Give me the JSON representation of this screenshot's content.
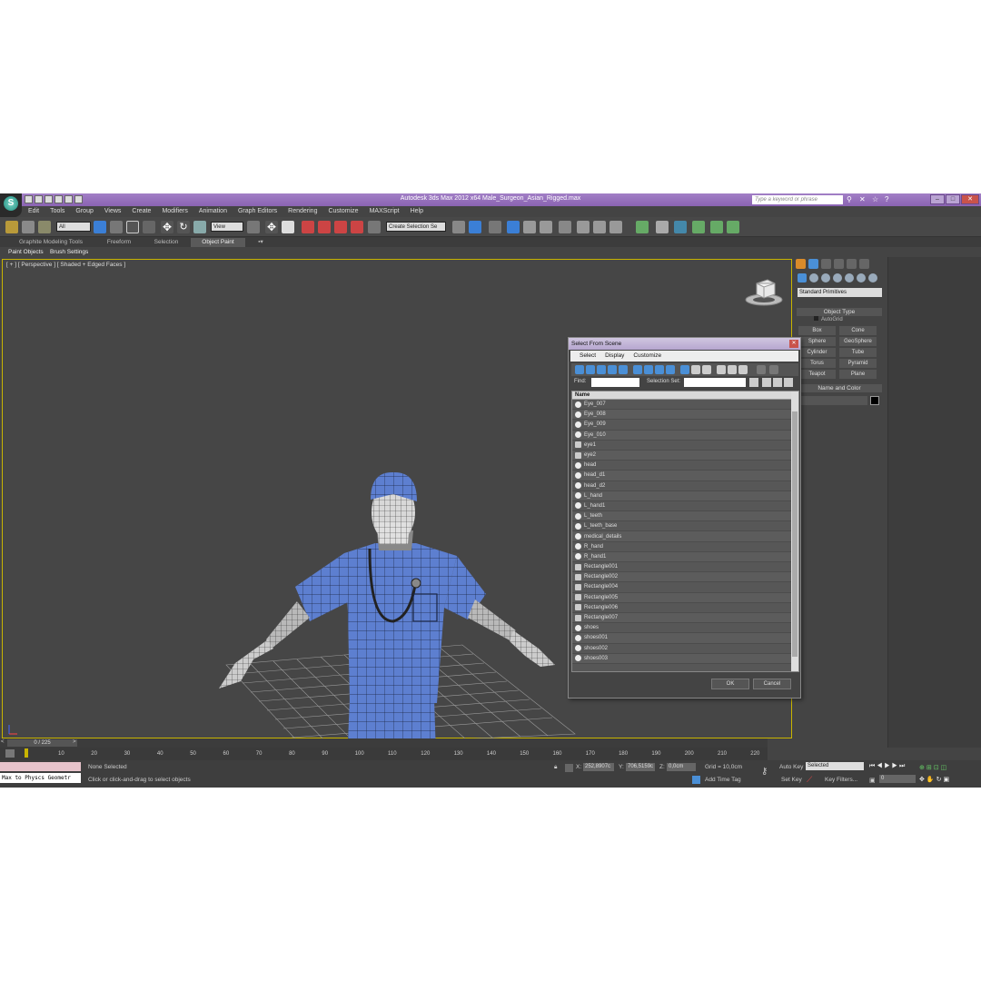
{
  "app": {
    "title": "Autodesk 3ds Max  2012 x64      Male_Surgeon_Asian_Rigged.max",
    "search_placeholder": "Type a keyword or phrase"
  },
  "menu": [
    "Edit",
    "Tools",
    "Group",
    "Views",
    "Create",
    "Modifiers",
    "Animation",
    "Graph Editors",
    "Rendering",
    "Customize",
    "MAXScript",
    "Help"
  ],
  "toolbar": {
    "filter_select": "All",
    "view_select": "View",
    "selection_set_placeholder": "Create Selection Se"
  },
  "ribbon": {
    "tabs": [
      "Graphite Modeling Tools",
      "Freeform",
      "Selection",
      "Object Paint"
    ],
    "active_tab": "Object Paint",
    "sub_items": [
      "Paint Objects",
      "Brush Settings"
    ]
  },
  "viewport": {
    "label": "[ + ] [ Perspective ] [ Shaded + Edged Faces ]"
  },
  "command_panel": {
    "dropdown": "Standard Primitives",
    "object_type_label": "Object Type",
    "autogrid_label": "AutoGrid",
    "buttons": [
      "Box",
      "Cone",
      "Sphere",
      "GeoSphere",
      "Cylinder",
      "Tube",
      "Torus",
      "Pyramid",
      "Teapot",
      "Plane"
    ],
    "name_color_label": "Name and Color"
  },
  "dialog": {
    "title": "Select From Scene",
    "menu": [
      "Select",
      "Display",
      "Customize"
    ],
    "find_label": "Find:",
    "selection_set_label": "Selection Set:",
    "column_name": "Name",
    "items": [
      "Eye_007",
      "Eye_008",
      "Eye_009",
      "Eye_010",
      "eye1",
      "eye2",
      "head",
      "head_d1",
      "head_d2",
      "L_hand",
      "L_hand1",
      "L_teeth",
      "L_teeth_base",
      "medical_details",
      "R_hand",
      "R_hand1",
      "Rectangle001",
      "Rectangle002",
      "Rectangle004",
      "Rectangle005",
      "Rectangle006",
      "Rectangle007",
      "shoes",
      "shoes001",
      "shoes002",
      "shoes003"
    ],
    "ok_label": "OK",
    "cancel_label": "Cancel"
  },
  "timeline": {
    "frame_label": "0 / 225",
    "ticks": [
      "10",
      "20",
      "30",
      "40",
      "50",
      "60",
      "70",
      "80",
      "90",
      "100",
      "110",
      "120",
      "130",
      "140",
      "150",
      "160",
      "170",
      "180",
      "190",
      "200",
      "210",
      "220"
    ]
  },
  "status": {
    "maxscript_text": "Max to Physcs Geometr",
    "selection_status": "None Selected",
    "prompt": "Click or click-and-drag to select objects",
    "x_label": "X:",
    "x_value": "252,8907c",
    "y_label": "Y:",
    "y_value": "706,5159c",
    "z_label": "Z:",
    "z_value": "0,0cm",
    "grid": "Grid = 10,0cm",
    "add_time_tag": "Add Time Tag",
    "auto_key": "Auto Key",
    "set_key": "Set Key",
    "key_filters": "Key Filters...",
    "selected": "Selected",
    "frame_value": "0"
  }
}
